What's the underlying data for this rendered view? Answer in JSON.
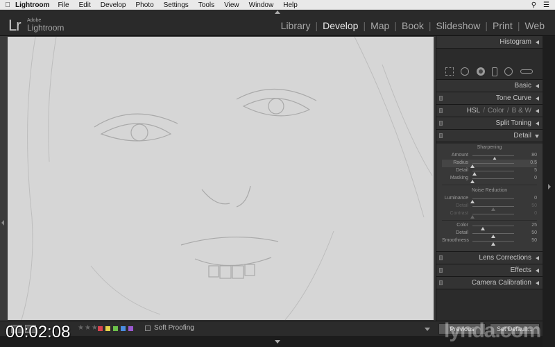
{
  "menubar": {
    "apple_icon": "apple-icon",
    "app": "Lightroom",
    "items": [
      "File",
      "Edit",
      "Develop",
      "Photo",
      "Settings",
      "Tools",
      "View",
      "Window",
      "Help"
    ]
  },
  "identity": {
    "logo": "Lr",
    "brand_top": "Adobe",
    "brand_name": "Lightroom"
  },
  "modules": {
    "items": [
      "Library",
      "Develop",
      "Map",
      "Book",
      "Slideshow",
      "Print",
      "Web"
    ],
    "active": "Develop"
  },
  "panels": {
    "histogram": "Histogram",
    "basic": "Basic",
    "tone_curve": "Tone Curve",
    "hsl": "HSL",
    "hsl_sep1": "/",
    "color": "Color",
    "hsl_sep2": "/",
    "bw": "B & W",
    "split_toning": "Split Toning",
    "detail": "Detail",
    "lens_corrections": "Lens Corrections",
    "effects": "Effects",
    "camera_calibration": "Camera Calibration"
  },
  "detail": {
    "sharpening_title": "Sharpening",
    "sharpening": [
      {
        "label": "Amount",
        "value": "80",
        "pos": 0.53
      },
      {
        "label": "Radius",
        "value": "0.5",
        "pos": 0.0
      },
      {
        "label": "Detail",
        "value": "5",
        "pos": 0.05
      },
      {
        "label": "Masking",
        "value": "0",
        "pos": 0.0
      }
    ],
    "noise_title": "Noise Reduction",
    "noise": [
      {
        "label": "Luminance",
        "value": "0",
        "pos": 0.0
      },
      {
        "label": "Detail",
        "value": "50",
        "pos": 0.5
      },
      {
        "label": "Contrast",
        "value": "0",
        "pos": 0.0
      }
    ],
    "color": [
      {
        "label": "Color",
        "value": "25",
        "pos": 0.25
      },
      {
        "label": "Detail",
        "value": "50",
        "pos": 0.5
      },
      {
        "label": "Smoothness",
        "value": "50",
        "pos": 0.5
      }
    ]
  },
  "toolbar": {
    "soft_proofing": "Soft Proofing",
    "stars": "★★★",
    "label_colors": [
      "#d8434f",
      "#e3d24a",
      "#6cc04a",
      "#4a8de0",
      "#9a58d0"
    ]
  },
  "panel_buttons": {
    "previous": "Previous",
    "reset": "Set Default..."
  },
  "overlay": {
    "timecode": "00:02:08",
    "watermark": "lynda.com"
  }
}
